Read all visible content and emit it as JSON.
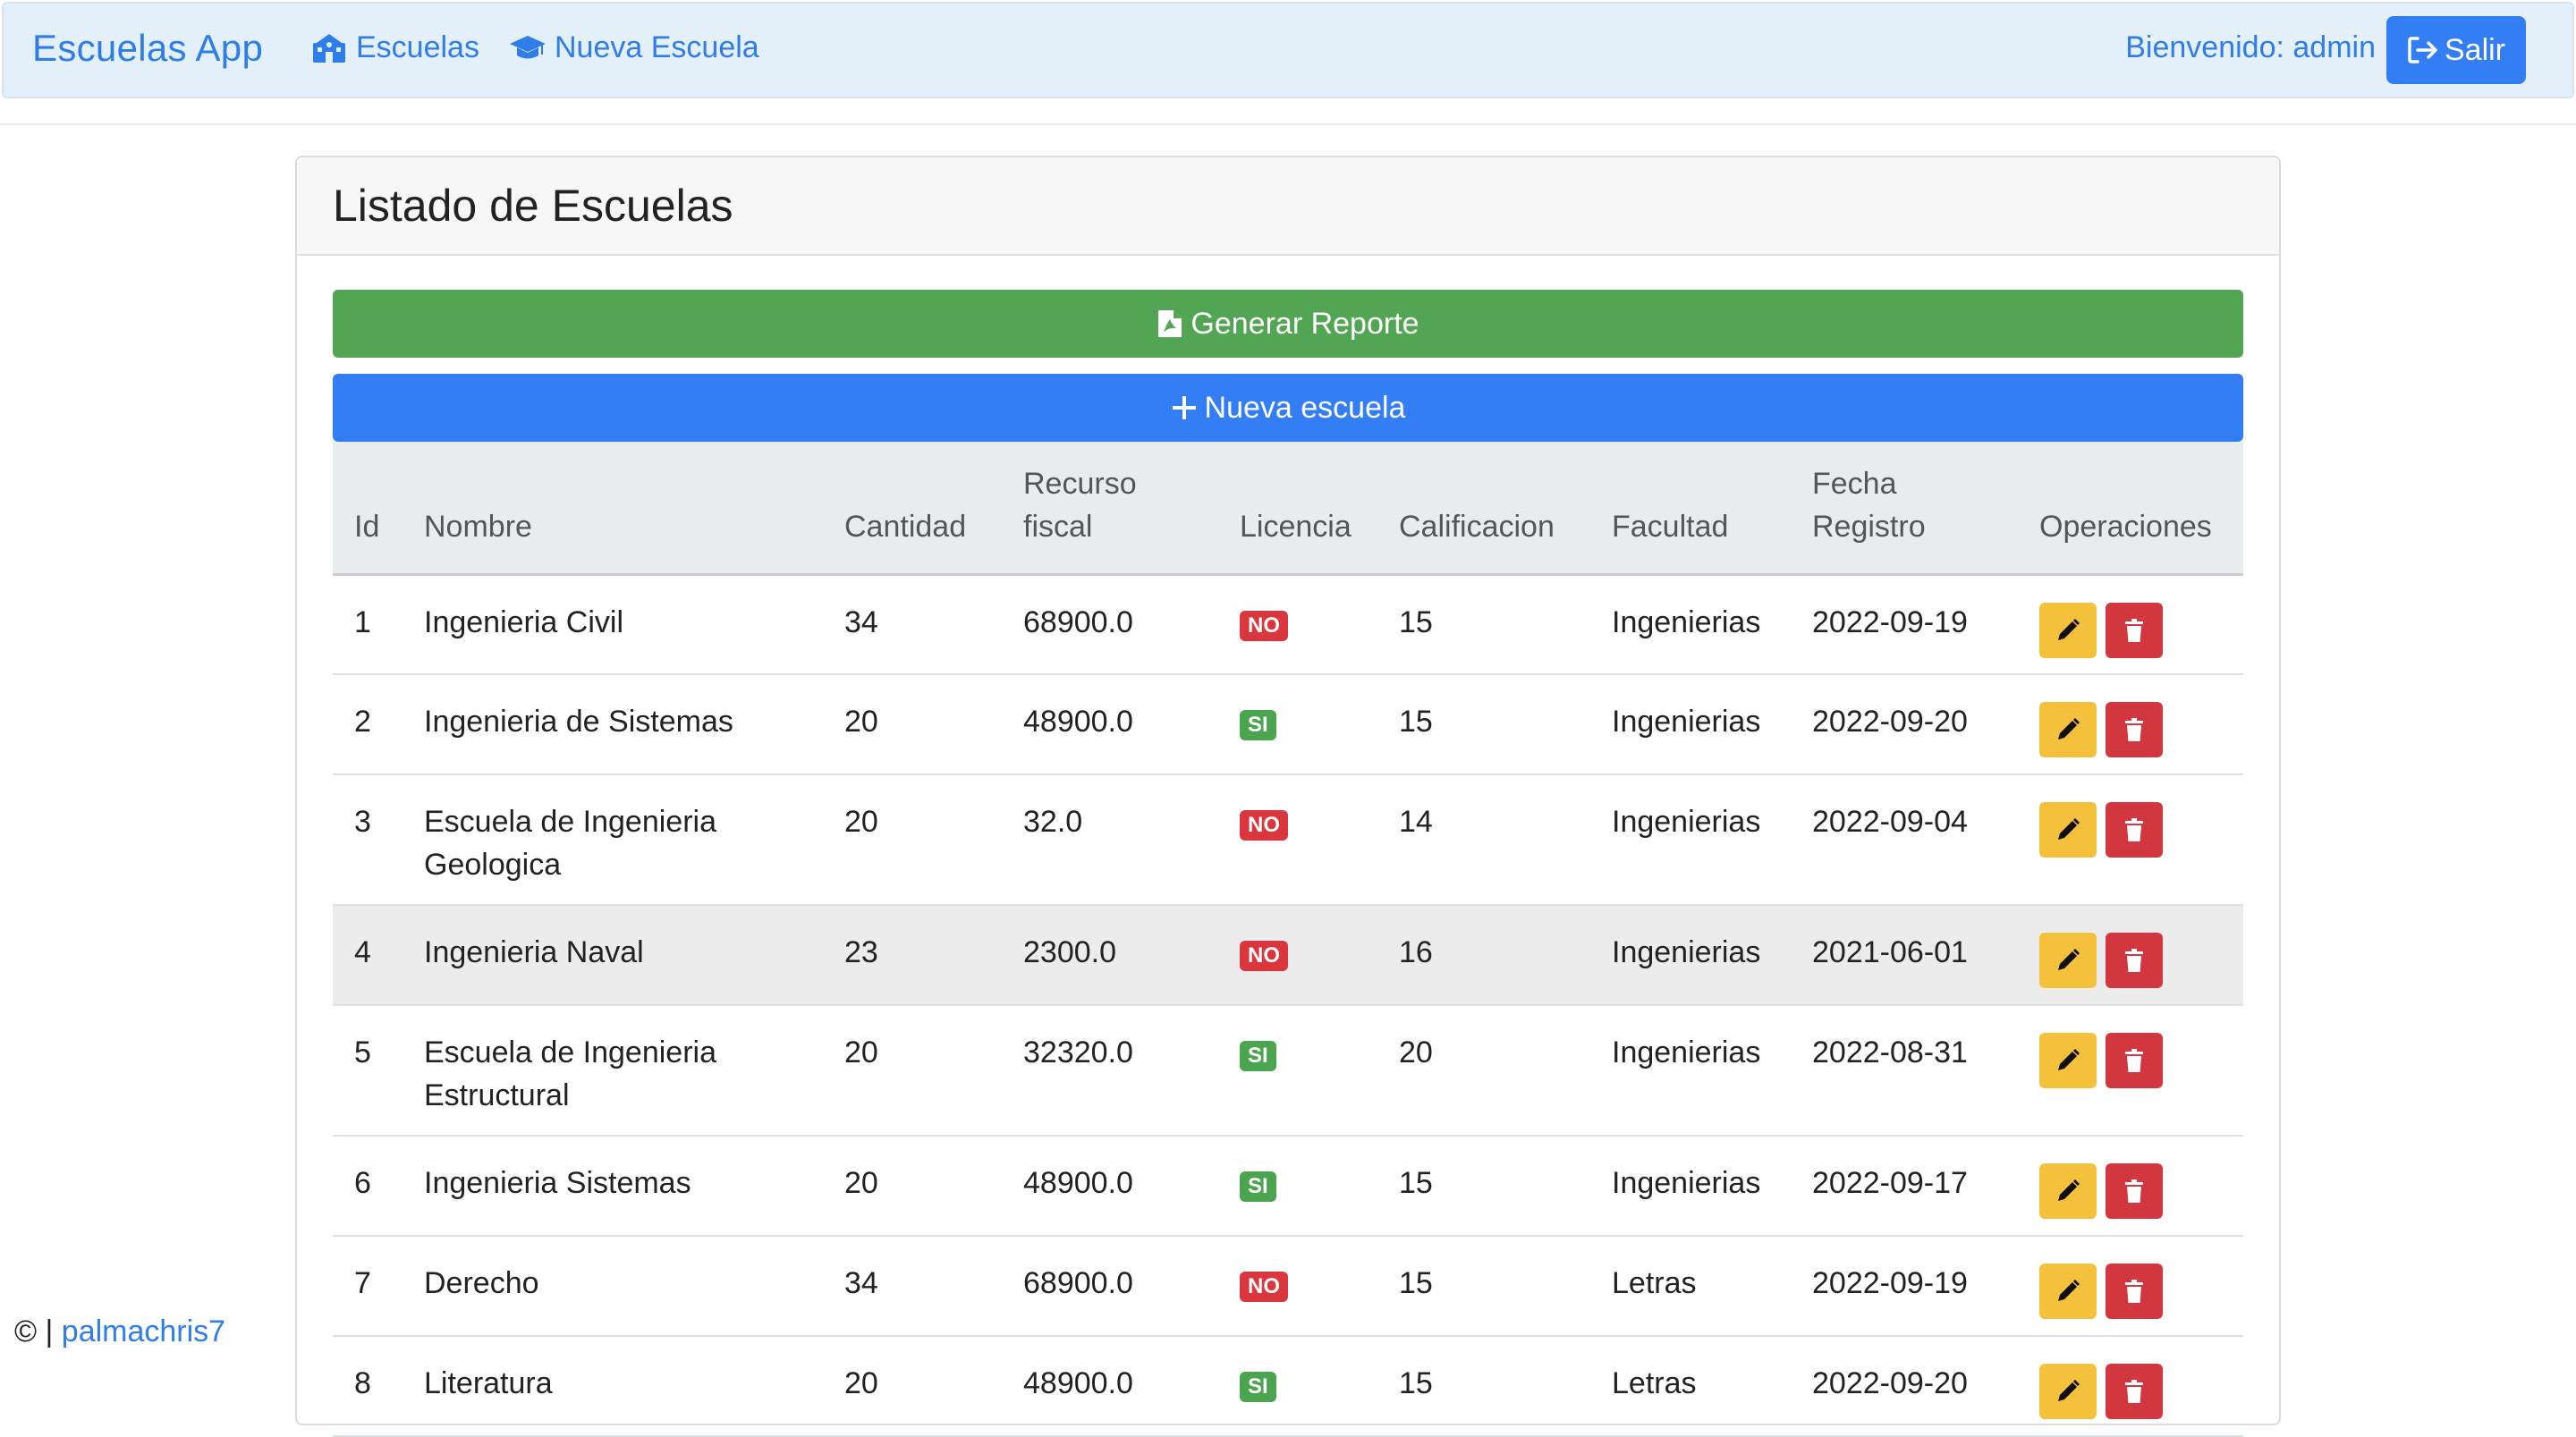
{
  "navbar": {
    "brand": "Escuelas App",
    "links": [
      {
        "label": "Escuelas",
        "icon": "school-icon"
      },
      {
        "label": "Nueva Escuela",
        "icon": "graduation-cap-icon"
      }
    ],
    "welcome": "Bienvenido: admin",
    "logout_label": "Salir"
  },
  "card": {
    "title": "Listado de Escuelas",
    "report_label": "Generar Reporte",
    "new_label": "Nueva escuela"
  },
  "table": {
    "headers": [
      "Id",
      "Nombre",
      "Cantidad",
      "Recurso fiscal",
      "Licencia",
      "Calificacion",
      "Facultad",
      "Fecha Registro",
      "Operaciones"
    ],
    "rows": [
      {
        "id": "1",
        "nombre": "Ingenieria Civil",
        "cantidad": "34",
        "recurso": "68900.0",
        "licencia": "NO",
        "calificacion": "15",
        "facultad": "Ingenierias",
        "fecha": "2022-09-19"
      },
      {
        "id": "2",
        "nombre": "Ingenieria de Sistemas",
        "cantidad": "20",
        "recurso": "48900.0",
        "licencia": "SI",
        "calificacion": "15",
        "facultad": "Ingenierias",
        "fecha": "2022-09-20"
      },
      {
        "id": "3",
        "nombre": "Escuela de Ingenieria Geologica",
        "cantidad": "20",
        "recurso": "32.0",
        "licencia": "NO",
        "calificacion": "14",
        "facultad": "Ingenierias",
        "fecha": "2022-09-04"
      },
      {
        "id": "4",
        "nombre": "Ingenieria Naval",
        "cantidad": "23",
        "recurso": "2300.0",
        "licencia": "NO",
        "calificacion": "16",
        "facultad": "Ingenierias",
        "fecha": "2021-06-01"
      },
      {
        "id": "5",
        "nombre": "Escuela de Ingenieria Estructural",
        "cantidad": "20",
        "recurso": "32320.0",
        "licencia": "SI",
        "calificacion": "20",
        "facultad": "Ingenierias",
        "fecha": "2022-08-31"
      },
      {
        "id": "6",
        "nombre": "Ingenieria Sistemas",
        "cantidad": "20",
        "recurso": "48900.0",
        "licencia": "SI",
        "calificacion": "15",
        "facultad": "Ingenierias",
        "fecha": "2022-09-17"
      },
      {
        "id": "7",
        "nombre": "Derecho",
        "cantidad": "34",
        "recurso": "68900.0",
        "licencia": "NO",
        "calificacion": "15",
        "facultad": "Letras",
        "fecha": "2022-09-19"
      },
      {
        "id": "8",
        "nombre": "Literatura",
        "cantidad": "20",
        "recurso": "48900.0",
        "licencia": "SI",
        "calificacion": "15",
        "facultad": "Letras",
        "fecha": "2022-09-20"
      }
    ]
  },
  "footer": {
    "prefix": "© |",
    "link": "palmachris7"
  },
  "colors": {
    "primary": "#337ef5",
    "success": "#52a552",
    "warning": "#f4c13c",
    "danger": "#d2363e",
    "navbar_bg": "#e3eff9"
  }
}
